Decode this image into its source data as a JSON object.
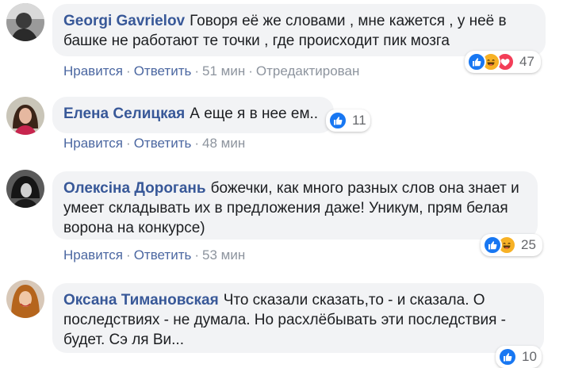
{
  "actions": {
    "like_label": "Нравится",
    "reply_label": "Ответить",
    "separator": "·"
  },
  "comments": [
    {
      "author": "Georgi Gavrielov",
      "text": "Говоря её же словами , мне кажется , у неё в башке не работают те точки , где происходит пик мозга",
      "time": "51 мин",
      "edited": "Отредактирован",
      "reaction_count": "47",
      "reactions": [
        "like-icon",
        "haha-icon",
        "love-icon"
      ]
    },
    {
      "author": "Елена Селицкая",
      "text": "А еще я в нее ем..",
      "time": "48 мин",
      "reaction_count": "11",
      "reactions": [
        "like-icon"
      ]
    },
    {
      "author": "Олексiна Дорогань",
      "text": "божечки, как много разных слов она знает и умеет складывать их в предложения даже! Уникум, прям белая ворона на конкурсе)",
      "time": "53 мин",
      "reaction_count": "25",
      "reactions": [
        "like-icon",
        "haha-icon"
      ]
    },
    {
      "author": "Оксана Тимановская",
      "text": "Что сказали сказать,то - и сказала. О последствиях - не думала. Но расхлёбывать эти последствия - будет. Сэ ля Ви...",
      "reaction_count": "10",
      "reactions": [
        "like-icon"
      ]
    }
  ],
  "colors": {
    "author": "#385898",
    "link": "#4b67a1",
    "bubble": "#f2f3f5",
    "like": "#1877f2",
    "haha": "#f7b125",
    "love": "#f33e58"
  }
}
